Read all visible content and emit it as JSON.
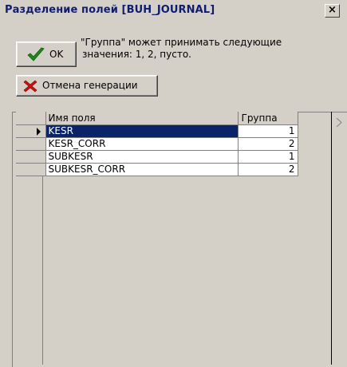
{
  "window": {
    "title": "Разделение полей [BUH_JOURNAL]",
    "close_symbol": "×"
  },
  "toolbar": {
    "ok_label": "OK",
    "info_line1": "\"Группа\" может принимать следующие",
    "info_line2": "значения: 1, 2, пусто.",
    "cancel_label": "Отмена генерации",
    "ok_icon": "checkmark-icon",
    "cancel_icon": "red-x-icon"
  },
  "grid": {
    "columns": [
      "Имя поля",
      "Группа"
    ],
    "rows": [
      {
        "name": "KESR",
        "group": "1",
        "selected": true
      },
      {
        "name": "KESR_CORR",
        "group": "2",
        "selected": false
      },
      {
        "name": "SUBKESR",
        "group": "1",
        "selected": false
      },
      {
        "name": "SUBKESR_CORR",
        "group": "2",
        "selected": false
      }
    ],
    "selection_color": "#0a246a"
  }
}
